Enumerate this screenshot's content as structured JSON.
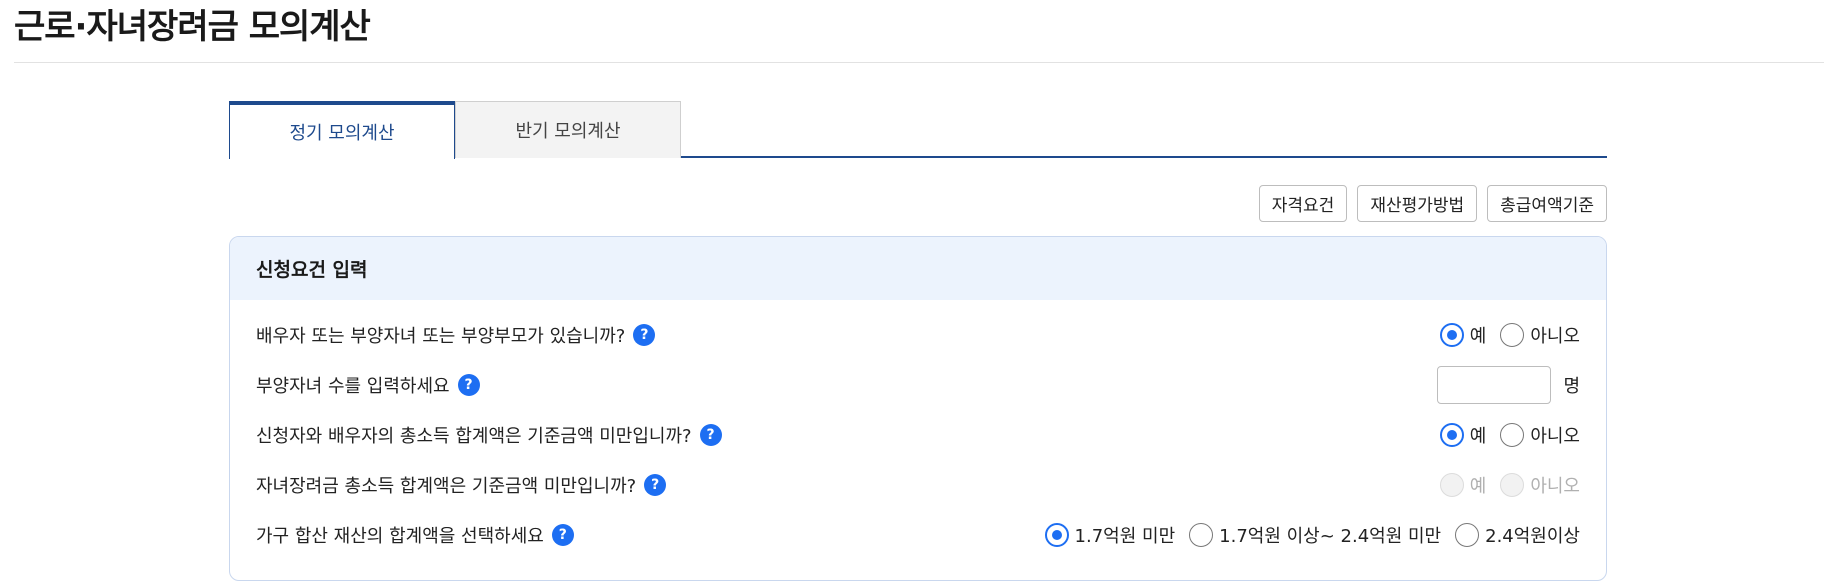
{
  "page": {
    "title": "근로·자녀장려금 모의계산"
  },
  "tabs": [
    {
      "label": "정기 모의계산",
      "active": true
    },
    {
      "label": "반기 모의계산",
      "active": false
    }
  ],
  "toolbar": {
    "buttons": [
      "자격요건",
      "재산평가방법",
      "총급여액기준"
    ]
  },
  "panel": {
    "title": "신청요건 입력",
    "help_glyph": "?",
    "questions": [
      {
        "label": "배우자 또는 부양자녀 또는 부양부모가 있습니까?",
        "options": [
          "예",
          "아니오"
        ],
        "selected": "예",
        "disabled": false
      },
      {
        "label": "부양자녀 수를 입력하세요",
        "input_value": "",
        "unit": "명"
      },
      {
        "label": "신청자와 배우자의 총소득 합계액은 기준금액 미만입니까?",
        "options": [
          "예",
          "아니오"
        ],
        "selected": "예",
        "disabled": false
      },
      {
        "label": "자녀장려금 총소득 합계액은 기준금액 미만입니까?",
        "options": [
          "예",
          "아니오"
        ],
        "selected": null,
        "disabled": true
      },
      {
        "label": "가구 합산 재산의 합계액을 선택하세요",
        "options": [
          "1.7억원 미만",
          "1.7억원 이상~ 2.4억원 미만",
          "2.4억원이상"
        ],
        "selected": "1.7억원 미만",
        "disabled": false
      }
    ]
  },
  "colors": {
    "accent": "#1e4a8d",
    "radio_blue": "#1d6ef2",
    "panel_header_bg": "#ecf3fd"
  }
}
